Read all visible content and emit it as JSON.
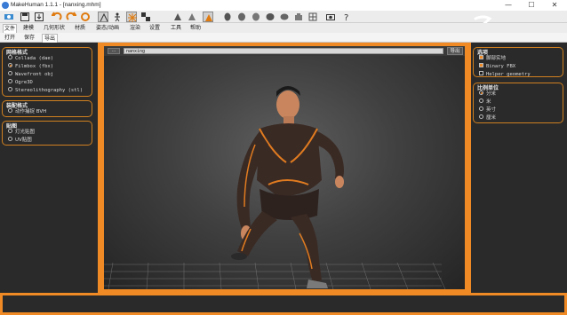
{
  "window": {
    "title": "MakeHuman 1.1.1 - [nanxing.mhm]",
    "controls": [
      "—",
      "☐",
      "✕"
    ]
  },
  "toolbar": {
    "icons": [
      "wireframe-icon",
      "save-icon",
      "export-icon",
      "undo-icon",
      "redo-icon",
      "reset-icon",
      "smooth-icon",
      "pose-icon",
      "subdivide-icon",
      "texture-icon",
      "front-view-icon",
      "back-view-icon",
      "side-view-icon",
      "head-front-icon",
      "head-left-icon",
      "head-right-icon",
      "top-view-icon",
      "bottom-view-icon",
      "grid-icon",
      "screenshot-icon",
      "help-icon"
    ]
  },
  "menu_tabs": [
    "文件",
    "建模",
    "几何形状",
    "材质",
    "姿态/动画",
    "渲染",
    "设置",
    "工具",
    "帮助"
  ],
  "active_menu_tab": "文件",
  "sub_tabs": [
    "打开",
    "保存",
    "导出"
  ],
  "active_sub_tab": "导出",
  "left_panel": {
    "mesh_format": {
      "title": "网格格式",
      "options": [
        "Collada (dae)",
        "Filmbox (fbx)",
        "Wavefront obj",
        "Ogre3D",
        "Stereolithography (stl)"
      ],
      "selected": "Filmbox (fbx)"
    },
    "rig_format": {
      "title": "装配格式",
      "options": [
        "动作捕捉 BVH"
      ]
    },
    "maps": {
      "title": "贴图",
      "options": [
        "灯光贴图",
        "UV贴图"
      ]
    }
  },
  "viewport": {
    "dots_button": "...",
    "filename": "nanxing",
    "export_button": "导出",
    "accent_color": "#f08a24"
  },
  "right_panel": {
    "options": {
      "title": "选项",
      "items": [
        {
          "label": "脚部实地",
          "checked": true
        },
        {
          "label": "Binary FBX",
          "checked": true
        },
        {
          "label": "Helper geometry",
          "checked": false
        }
      ]
    },
    "scale_units": {
      "title": "比例单位",
      "options": [
        "分米",
        "米",
        "英寸",
        "厘米"
      ],
      "selected": "分米"
    }
  },
  "colors": {
    "accent": "#f08a24",
    "panel": "#2a2a2a"
  }
}
